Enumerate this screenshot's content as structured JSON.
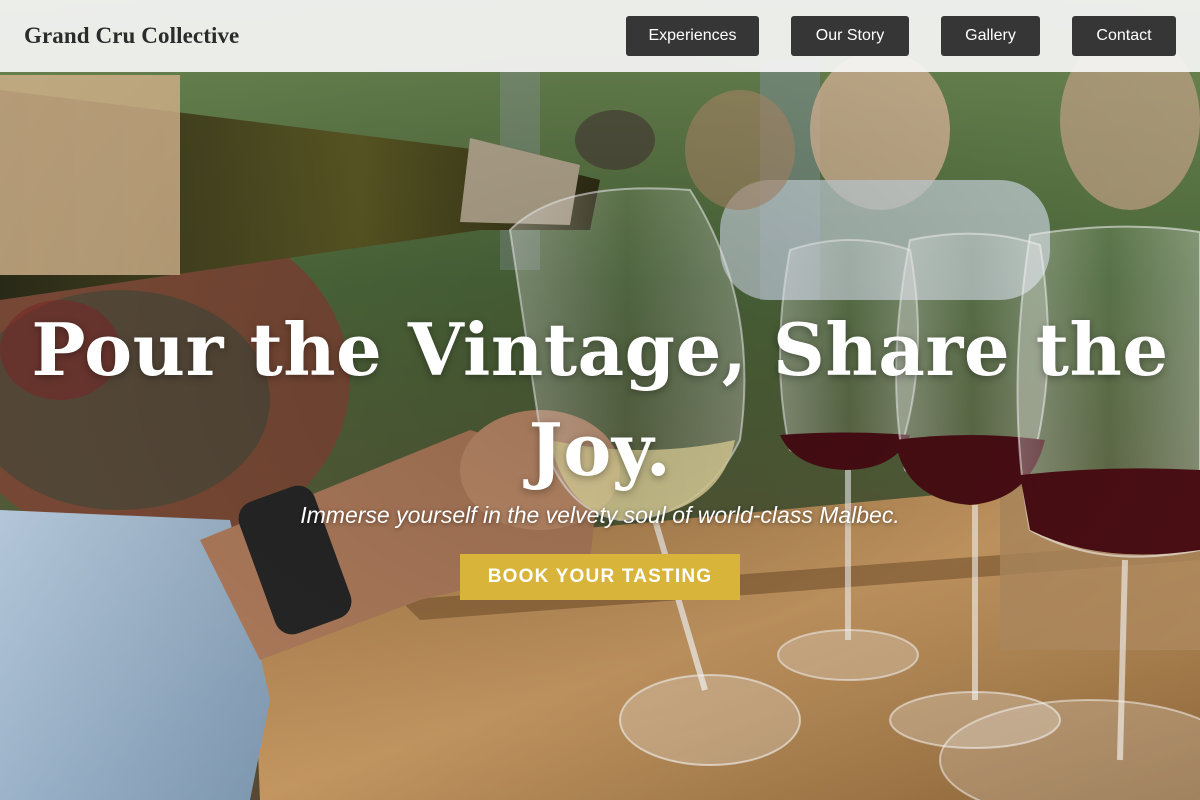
{
  "brand": {
    "name": "Grand Cru Collective"
  },
  "nav": {
    "items": [
      {
        "label": "Experiences"
      },
      {
        "label": "Our Story"
      },
      {
        "label": "Gallery"
      },
      {
        "label": "Contact"
      }
    ]
  },
  "hero": {
    "title": "Pour the Vintage, Share the Joy.",
    "subtitle": "Immerse yourself in the velvety soul of world-class Malbec.",
    "cta_label": "BOOK YOUR TASTING",
    "image_icon": "wine-tasting-photo"
  },
  "colors": {
    "navbar_bg": "#f5f5f5",
    "nav_button_bg": "#363636",
    "cta_bg": "#d8b53a",
    "text_light": "#ffffff",
    "brand_text": "#2b2b2b"
  }
}
